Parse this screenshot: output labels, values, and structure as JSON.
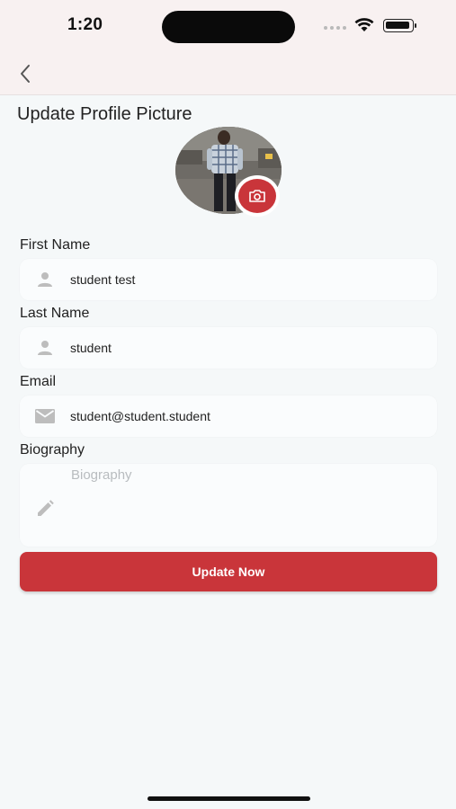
{
  "status_bar": {
    "time": "1:20"
  },
  "page": {
    "title": "Update Profile Picture"
  },
  "fields": {
    "first_name": {
      "label": "First Name",
      "value": "student test",
      "icon": "person-icon"
    },
    "last_name": {
      "label": "Last Name",
      "value": "student",
      "icon": "person-icon"
    },
    "email": {
      "label": "Email",
      "value": "student@student.student",
      "icon": "mail-icon"
    },
    "biography": {
      "label": "Biography",
      "placeholder": "Biography",
      "icon": "pencil-icon"
    }
  },
  "actions": {
    "update_label": "Update Now"
  },
  "colors": {
    "accent": "#c9353a",
    "header_bg": "#f8f1f1",
    "page_bg": "#f5f8f9"
  }
}
